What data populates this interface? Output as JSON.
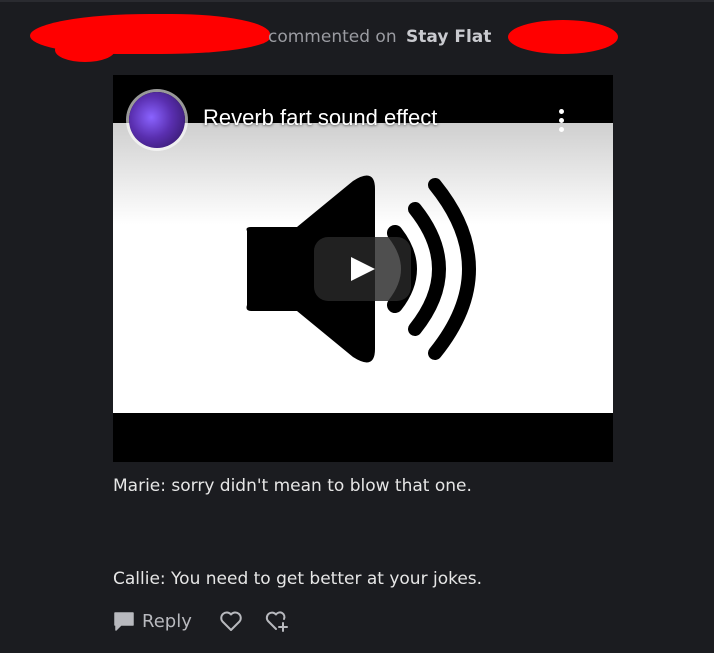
{
  "header": {
    "action_text": "commented on",
    "group_name": "Stay Flat"
  },
  "video": {
    "title": "Reverb fart sound effect",
    "channel_avatar_icon": "channel-avatar",
    "menu_icon": "kebab-menu-icon",
    "play_icon": "play-icon",
    "thumbnail_icon": "speaker-volume-icon"
  },
  "comment": {
    "lines": [
      "Marie: sorry didn't mean to blow that one.",
      "Callie: You need to get better at your jokes."
    ]
  },
  "actions": {
    "reply_label": "Reply",
    "reply_icon": "speech-bubble-icon",
    "like_icon": "heart-icon",
    "react_icon": "heart-plus-icon"
  },
  "colors": {
    "background": "#1b1c20",
    "redaction": "#ff0000",
    "muted_text": "#9a9ba1",
    "body_text": "#e6e6e6"
  }
}
